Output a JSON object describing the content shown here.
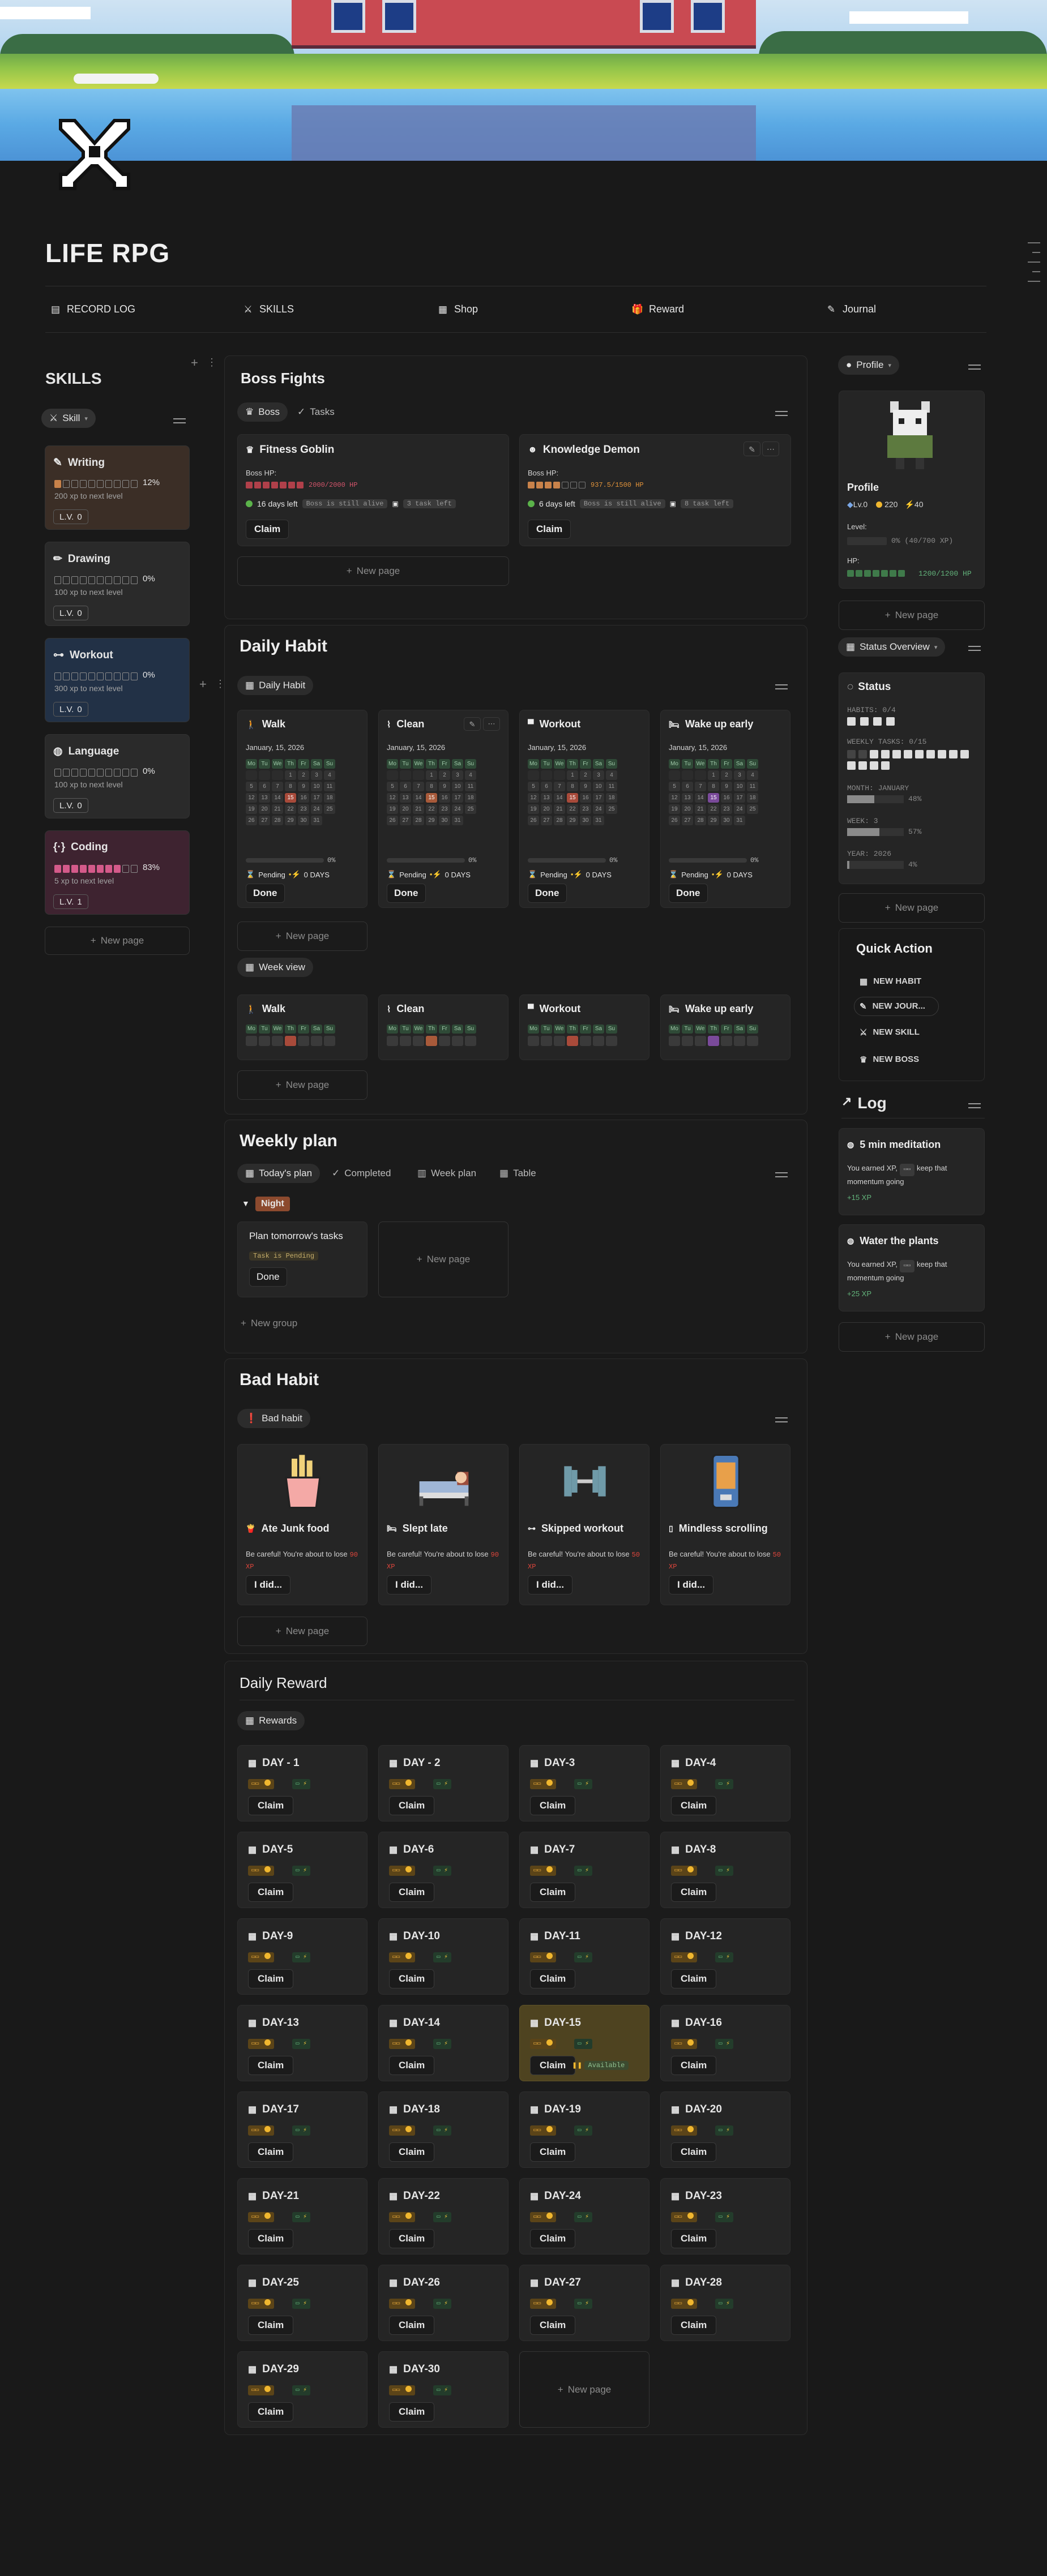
{
  "page": {
    "title": "LIFE RPG"
  },
  "nav": [
    {
      "icon": "document-icon",
      "label": "RECORD LOG"
    },
    {
      "icon": "sword-icon",
      "label": "SKILLS"
    },
    {
      "icon": "shop-icon",
      "label": "Shop"
    },
    {
      "icon": "gift-icon",
      "label": "Reward"
    },
    {
      "icon": "pen-icon",
      "label": "Journal"
    }
  ],
  "skills": {
    "title": "SKILLS",
    "view_label": "Skill",
    "new_page": "New page",
    "items": [
      {
        "name": "Writing",
        "icon": "pen-icon",
        "percent": "12%",
        "progress": 0.12,
        "next": "200 xp to next level",
        "level_label": "L.V.",
        "level": "0",
        "color": "#3b2e26"
      },
      {
        "name": "Drawing",
        "icon": "pencil-icon",
        "percent": "0%",
        "progress": 0,
        "next": "100 xp to next level",
        "level_label": "L.V.",
        "level": "0",
        "color": "#2a2a2a"
      },
      {
        "name": "Workout",
        "icon": "dumbbell-icon",
        "percent": "0%",
        "progress": 0,
        "next": "300 xp to next level",
        "level_label": "L.V.",
        "level": "0",
        "color": "#223146"
      },
      {
        "name": "Language",
        "icon": "globe-icon",
        "percent": "0%",
        "progress": 0,
        "next": "100 xp to next level",
        "level_label": "L.V.",
        "level": "0",
        "color": "#2a2a2a"
      },
      {
        "name": "Coding",
        "icon": "code-icon",
        "percent": "83%",
        "progress": 0.83,
        "next": "5 xp to next level",
        "level_label": "L.V.",
        "level": "1",
        "color": "#3e2330"
      }
    ]
  },
  "boss": {
    "title": "Boss Fights",
    "tabs": [
      "Boss",
      "Tasks"
    ],
    "hp_label": "Boss HP:",
    "new_page": "New page",
    "cards": [
      {
        "name": "Fitness Goblin",
        "hp_text": "2000/2000 HP",
        "hp_filled": 7,
        "hp_total": 7,
        "days": "16 days left",
        "alive": "Boss is still alive",
        "tasks": "3 task left",
        "claim": "Claim"
      },
      {
        "name": "Knowledge Demon",
        "hp_text": "937.5/1500 HP",
        "hp_filled": 4,
        "hp_total": 7,
        "days": "6 days left",
        "alive": "Boss is still alive",
        "tasks": "8 task left",
        "claim": "Claim"
      }
    ]
  },
  "daily_habit": {
    "title": "Daily Habit",
    "tab": "Daily Habit",
    "week_tab": "Week view",
    "new_page": "New page",
    "date": "January, 15, 2026",
    "weekdays": [
      "Mo",
      "Tu",
      "We",
      "Th",
      "Fr",
      "Sa",
      "Su"
    ],
    "pending": "Pending",
    "days": "0 DAYS",
    "done": "Done",
    "progress_pct": "0%",
    "habits": [
      {
        "name": "Walk",
        "icon": "walk-icon",
        "today_color": "#a84a3a"
      },
      {
        "name": "Clean",
        "icon": "broom-icon",
        "today_color": "#a85a3a"
      },
      {
        "name": "Workout",
        "icon": "hat-icon",
        "today_color": "#a84a3a"
      },
      {
        "name": "Wake up early",
        "icon": "bed-icon",
        "today_color": "#7a4a9a"
      }
    ]
  },
  "weekly_plan": {
    "title": "Weekly plan",
    "tabs": [
      "Today's plan",
      "Completed",
      "Week plan",
      "Table"
    ],
    "group": "Night",
    "task": "Plan tomorrow's tasks",
    "task_status": "Task is Pending",
    "done": "Done",
    "new_page": "New page",
    "new_group": "New group"
  },
  "bad_habit": {
    "title": "Bad Habit",
    "tab": "Bad habit",
    "new_page": "New page",
    "warn": "Be careful! You're about to lose",
    "btn": "I did...",
    "items": [
      {
        "name": "Ate Junk food",
        "icon": "fries-icon",
        "xp": "90 XP"
      },
      {
        "name": "Slept late",
        "icon": "bed-icon",
        "xp": "90 XP"
      },
      {
        "name": "Skipped workout",
        "icon": "dumbbell-icon",
        "xp": "50 XP"
      },
      {
        "name": "Mindless scrolling",
        "icon": "phone-icon",
        "xp": "50 XP"
      }
    ]
  },
  "daily_reward": {
    "title": "Daily Reward",
    "tab": "Rewards",
    "claim": "Claim",
    "new_page": "New page",
    "days": [
      "DAY - 1",
      "DAY - 2",
      "DAY-3",
      "DAY-4",
      "DAY-5",
      "DAY-6",
      "DAY-7",
      "DAY-8",
      "DAY-9",
      "DAY-10",
      "DAY-11",
      "DAY-12",
      "DAY-13",
      "DAY-14",
      "DAY-15",
      "DAY-16",
      "DAY-17",
      "DAY-18",
      "DAY-19",
      "DAY-20",
      "DAY-21",
      "DAY-22",
      "DAY-24",
      "DAY-23",
      "DAY-25",
      "DAY-26",
      "DAY-27",
      "DAY-28",
      "DAY-29",
      "DAY-30"
    ],
    "highlight": "DAY-15",
    "claimed": "Available"
  },
  "profile": {
    "tab": "Profile",
    "name": "Profile",
    "level": "Lv.0",
    "gold": "220",
    "energy": "40",
    "level_label": "Level:",
    "xp_text": "0% (40/700 XP)",
    "hp_label": "HP:",
    "hp_text": "1200/1200 HP",
    "new_page": "New page"
  },
  "status": {
    "tab": "Status Overview",
    "title": "Status",
    "habits": "HABITS: 0/4",
    "weekly_tasks": "WEEKLY TASKS: 0/15",
    "month": "MONTH: JANUARY",
    "month_pct": "48%",
    "week": "WEEK: 3",
    "week_pct": "57%",
    "year": "YEAR: 2026",
    "year_pct": "4%",
    "month_val": 0.48,
    "week_val": 0.57,
    "year_val": 0.04,
    "new_page": "New page"
  },
  "quick_action": {
    "title": "Quick Action",
    "items": [
      "NEW HABIT",
      "NEW JOUR...",
      "NEW SKILL",
      "NEW BOSS"
    ]
  },
  "log": {
    "title": "Log",
    "new_page": "New page",
    "entries": [
      {
        "title": "5 min meditation",
        "text1": "You earned XP,",
        "xp": "+15 XP",
        "text2": "keep that momentum going"
      },
      {
        "title": "Water the plants",
        "text1": "You earned XP,",
        "xp": "+25 XP",
        "text2": "keep that momentum going"
      }
    ]
  },
  "colors": {
    "bg": "#191919",
    "accent": "#c8824a",
    "xp_green": "#62b27a",
    "gold": "#f0b72f"
  }
}
